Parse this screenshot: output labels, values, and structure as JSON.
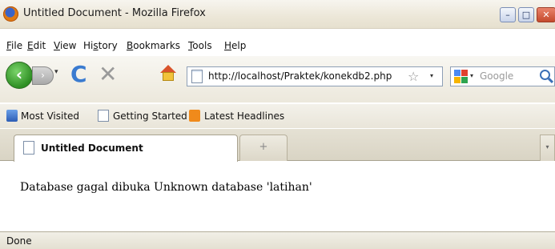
{
  "window": {
    "title": "Untitled Document - Mozilla Firefox",
    "controls": {
      "minimize": "–",
      "maximize": "□",
      "close": "✕"
    }
  },
  "menubar": {
    "items": [
      {
        "accel": "F",
        "rest": "ile"
      },
      {
        "accel": "E",
        "rest": "dit"
      },
      {
        "accel": "V",
        "rest": "iew"
      },
      {
        "pre": "Hi",
        "accel": "s",
        "rest": "tory"
      },
      {
        "accel": "B",
        "rest": "ookmarks"
      },
      {
        "accel": "T",
        "rest": "ools"
      },
      {
        "accel": "H",
        "rest": "elp"
      }
    ]
  },
  "navigation": {
    "back_glyph": "‹",
    "forward_glyph": "›",
    "dropdown_glyph": "▾",
    "reload_glyph": "C",
    "stop_glyph": "✕",
    "url": "http://localhost/Praktek/konekdb2.php",
    "bookmark_star_glyph": "☆",
    "search_placeholder": "Google"
  },
  "bookmarks": {
    "items": [
      {
        "label": "Most Visited",
        "icon": "most-visited-icon"
      },
      {
        "label": "Getting Started",
        "icon": "page-icon"
      },
      {
        "label": "Latest Headlines",
        "icon": "rss-icon"
      }
    ]
  },
  "tabs": {
    "items": [
      {
        "label": "Untitled Document",
        "active": true
      }
    ],
    "new_tab_glyph": "+",
    "list_glyph": "▾"
  },
  "content": {
    "text": "Database gagal dibuka Unknown database 'latihan'"
  },
  "status": {
    "text": "Done"
  },
  "colors": {
    "chrome": "#ece8dc",
    "back_button": "#2f8f24",
    "reload": "#3a7bd0",
    "rss": "#f08a1b",
    "close_button": "#c44a2c"
  }
}
